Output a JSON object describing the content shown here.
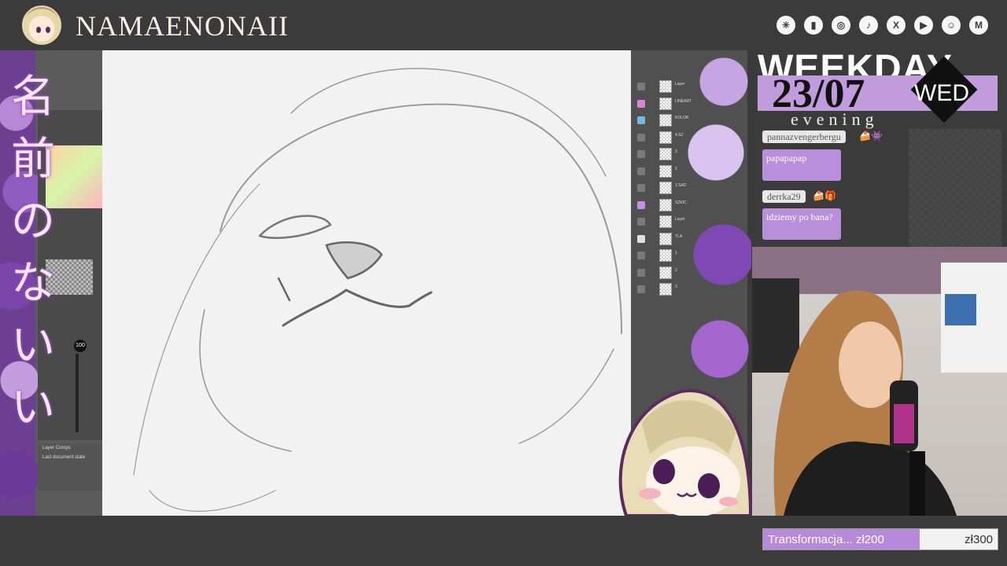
{
  "header": {
    "brand": "NAMAENONAII",
    "socials": [
      {
        "icon": "linktree-icon",
        "glyph": "✳"
      },
      {
        "icon": "twitch-icon",
        "glyph": "▮"
      },
      {
        "icon": "instagram-icon",
        "glyph": "◎"
      },
      {
        "icon": "tiktok-icon",
        "glyph": "♪"
      },
      {
        "icon": "x-icon",
        "glyph": "X"
      },
      {
        "icon": "youtube-icon",
        "glyph": "▶"
      },
      {
        "icon": "discord-icon",
        "glyph": "☺"
      },
      {
        "icon": "gmail-icon",
        "glyph": "M"
      }
    ]
  },
  "sidebar": {
    "title_lines": [
      "名",
      "前",
      "の",
      "な",
      "い",
      "い"
    ],
    "opacity_label": "100",
    "comps_label": "Layer Comps",
    "comps_item": "Last document state"
  },
  "layers": [
    {
      "label": "Layer",
      "eye": "#7a7a7a"
    },
    {
      "label": "LINEART",
      "eye": "#d784d7"
    },
    {
      "label": "KOLOR",
      "eye": "#7ab7e0"
    },
    {
      "label": "4.SZ",
      "eye": "#7a7a7a"
    },
    {
      "label": "3",
      "eye": "#7a7a7a"
    },
    {
      "label": "2",
      "eye": "#7a7a7a"
    },
    {
      "label": "1.SAD",
      "eye": "#7a7a7a"
    },
    {
      "label": "SZKIC",
      "eye": "#c58ee0"
    },
    {
      "label": "Layer",
      "eye": "#7a7a7a"
    },
    {
      "label": "TLA",
      "eye": "#e0e0e0"
    },
    {
      "label": "1",
      "eye": "#7a7a7a"
    },
    {
      "label": "2",
      "eye": "#7a7a7a"
    },
    {
      "label": "3",
      "eye": "#7a7a7a"
    }
  ],
  "stream": {
    "weekday_banner": "WEEKDAY",
    "date": "23/07",
    "day": "WED",
    "time_of_day": "evening"
  },
  "chat": [
    {
      "user": "pannazvengerbergu",
      "emotes": "🍰👾",
      "message": "papapapap"
    },
    {
      "user": "derrka29",
      "emotes": "🍰🎁",
      "message": "idziemy po bana?"
    }
  ],
  "goal": {
    "label": "Transformacja... zł200",
    "target": "zł300",
    "progress": 0.667
  },
  "colors": {
    "accent": "#c29bdc",
    "chat_bubble": "#b98fdb",
    "bar_bg": "#3b3b3b"
  }
}
